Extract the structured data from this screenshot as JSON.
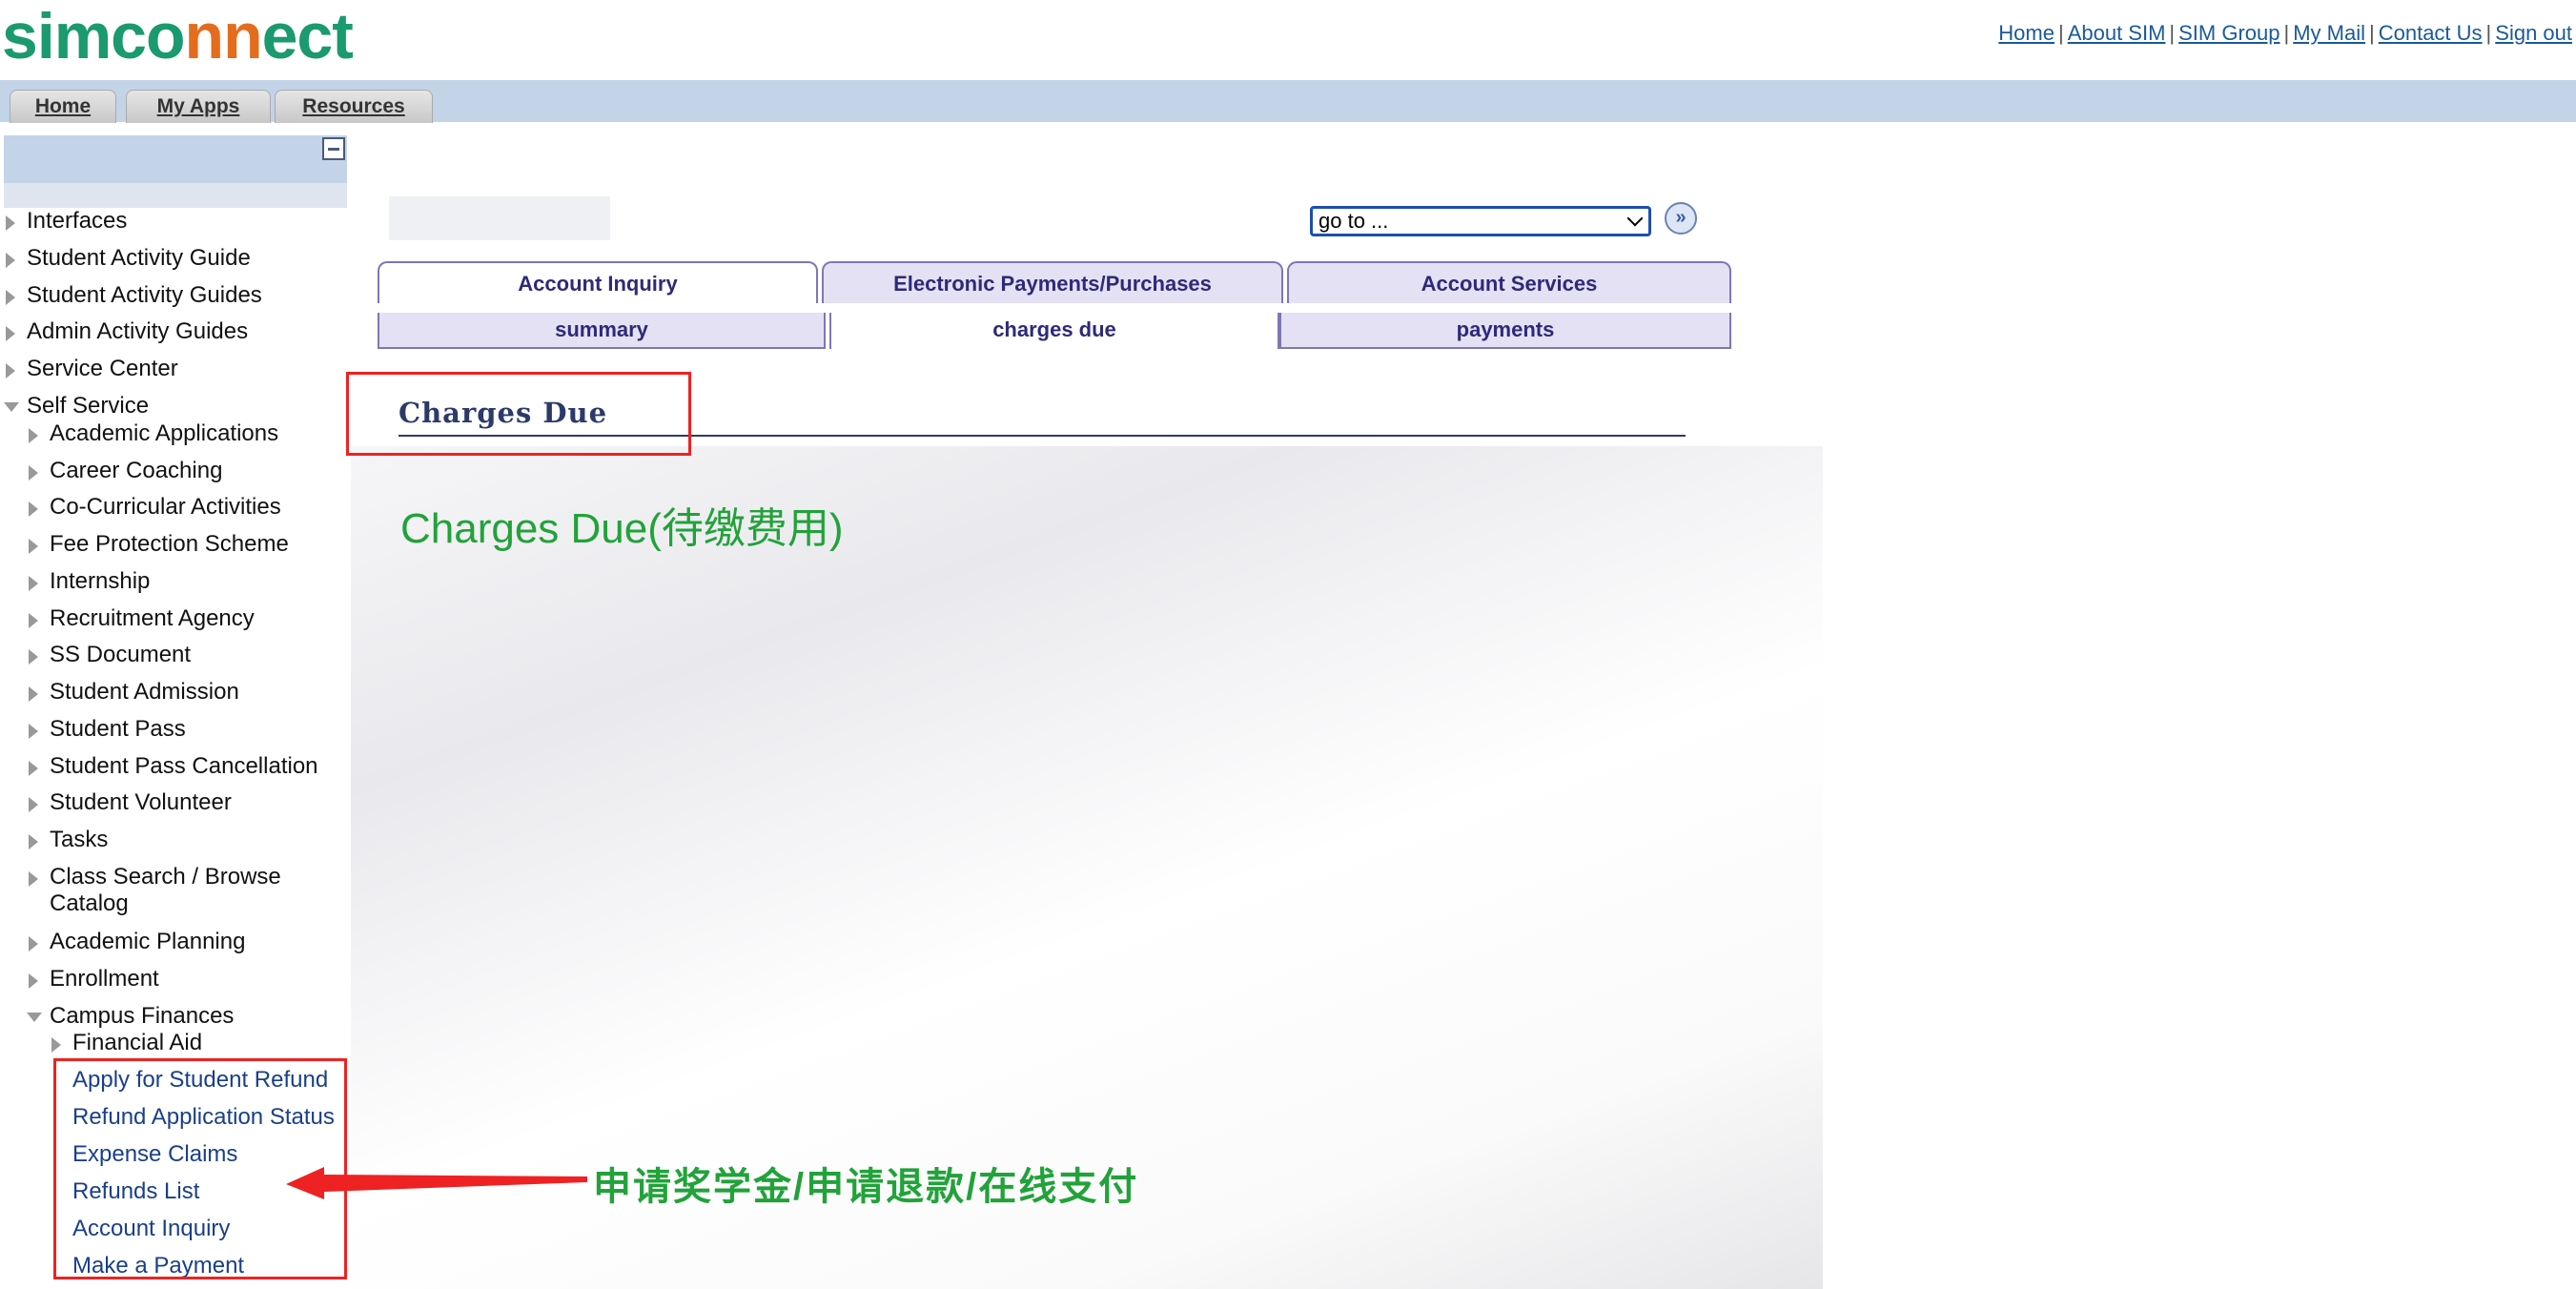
{
  "logo": {
    "text_a": "simco",
    "text_b": "nn",
    "text_c": "ect"
  },
  "top_links": [
    "Home",
    "About SIM",
    "SIM Group",
    "My Mail",
    "Contact Us",
    "Sign out"
  ],
  "top_separator": "|",
  "nav_tabs": [
    "Home",
    "My Apps",
    "Resources"
  ],
  "sidebar": {
    "root_items": [
      "Interfaces",
      "Student Activity Guide",
      "Student Activity Guides",
      "Admin Activity Guides",
      "Service Center"
    ],
    "self_service": "Self Service",
    "self_service_items": [
      "Academic Applications",
      "Career Coaching",
      "Co-Curricular Activities",
      "Fee Protection Scheme",
      "Internship",
      "Recruitment Agency",
      "SS Document",
      "Student Admission",
      "Student Pass",
      "Student Pass Cancellation",
      "Student Volunteer",
      "Tasks"
    ],
    "class_search_line1": "Class Search / Browse",
    "class_search_line2": "Catalog",
    "more_items": [
      "Academic Planning",
      "Enrollment"
    ],
    "campus_finances": "Campus Finances",
    "financial_aid": "Financial Aid",
    "finance_links": [
      "Apply for Student Refund",
      "Refund Application Status",
      "Expense Claims",
      "Refunds List",
      "Account Inquiry",
      "Make a Payment"
    ]
  },
  "goto": {
    "value": "go to ..."
  },
  "go_button": "»",
  "tabs_primary": [
    "Account Inquiry",
    "Electronic Payments/Purchases",
    "Account Services"
  ],
  "tabs_secondary": [
    "summary",
    "charges due",
    "payments"
  ],
  "page_title": "Charges Due",
  "annotation_title": "Charges Due(待缴费用)",
  "annotation_note": "申请奖学金/申请退款/在线支付",
  "colors": {
    "annotation_green": "#22a23a",
    "highlight_red": "#ee2222",
    "tab_purple": "#2d2a7a",
    "nav_blue": "#c3d4e8"
  }
}
